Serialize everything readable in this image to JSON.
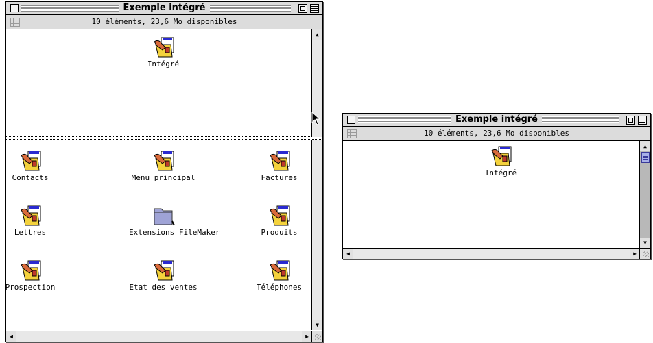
{
  "windows": [
    {
      "title": "Exemple intégré",
      "info": "10 éléments, 23,6  Mo disponibles",
      "top_pane_item": {
        "label": "Intégré",
        "icon": "filemaker-solution-icon"
      },
      "items": [
        {
          "label": "Contacts",
          "icon": "filemaker-solution-icon"
        },
        {
          "label": "Menu principal",
          "icon": "filemaker-solution-icon"
        },
        {
          "label": "Factures",
          "icon": "filemaker-solution-icon"
        },
        {
          "label": "Lettres",
          "icon": "filemaker-solution-icon"
        },
        {
          "label": "Extensions FileMaker",
          "icon": "folder-icon"
        },
        {
          "label": "Produits",
          "icon": "filemaker-solution-icon"
        },
        {
          "label": "Prospection",
          "icon": "filemaker-solution-icon"
        },
        {
          "label": "Etat des ventes",
          "icon": "filemaker-solution-icon"
        },
        {
          "label": "Téléphones",
          "icon": "filemaker-solution-icon"
        }
      ]
    },
    {
      "title": "Exemple intégré",
      "info": "10 éléments, 23,6  Mo disponibles",
      "items": [
        {
          "label": "Intégré",
          "icon": "filemaker-solution-icon"
        }
      ]
    }
  ],
  "colors": {
    "titlebar": "#dcdcdc",
    "scrollbar": "#e8e8e8",
    "thumb": "#a8b0e8",
    "folder": "#9fa3d6"
  }
}
